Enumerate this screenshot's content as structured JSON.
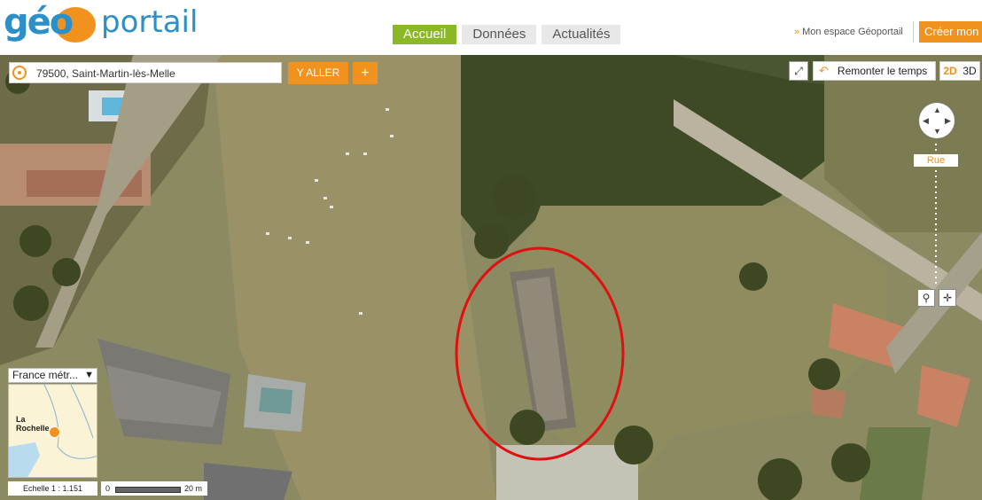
{
  "header": {
    "logo_geo": "géo",
    "logo_portail": "portail",
    "nav": [
      {
        "label": "Accueil",
        "active": true
      },
      {
        "label": "Données",
        "active": false
      },
      {
        "label": "Actualités",
        "active": false
      }
    ],
    "my_space": "Mon espace Géoportail",
    "create_account": "Créer mon c"
  },
  "search": {
    "value": "79500, Saint-Martin-lès-Melle",
    "go_label": "Y ALLER",
    "plus_label": "+"
  },
  "toolbar": {
    "time_label": "Remonter le temps",
    "dim_2d": "2D",
    "dim_3d": "3D"
  },
  "navigation": {
    "zoom_level_label": "Rue"
  },
  "minimap": {
    "region_select": "France métr...",
    "city_label": "La Rochelle"
  },
  "scale": {
    "ratio_label": "Echelle 1 :",
    "ratio_value": "1.151",
    "bar_start": "0",
    "bar_end": "20 m"
  },
  "colors": {
    "brand_orange": "#f0921d",
    "brand_green": "#8bb925",
    "brand_blue": "#2d8fc7",
    "highlight_red": "#e01010"
  }
}
